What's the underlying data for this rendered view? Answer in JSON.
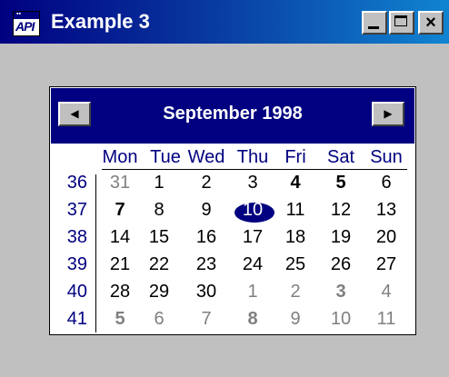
{
  "window": {
    "title": "Example 3",
    "icon": "app-icon"
  },
  "calendar": {
    "month": "September 1998",
    "days_of_week": [
      "Mon",
      "Tue",
      "Wed",
      "Thu",
      "Fri",
      "Sat",
      "Sun"
    ],
    "weeks": [
      {
        "num": "36",
        "days": [
          {
            "d": "31",
            "muted": true
          },
          {
            "d": "1"
          },
          {
            "d": "2"
          },
          {
            "d": "3"
          },
          {
            "d": "4",
            "bold": true
          },
          {
            "d": "5",
            "bold": true
          },
          {
            "d": "6"
          }
        ]
      },
      {
        "num": "37",
        "days": [
          {
            "d": "7",
            "bold": true
          },
          {
            "d": "8"
          },
          {
            "d": "9"
          },
          {
            "d": "10",
            "today": true
          },
          {
            "d": "11"
          },
          {
            "d": "12"
          },
          {
            "d": "13"
          }
        ]
      },
      {
        "num": "38",
        "days": [
          {
            "d": "14"
          },
          {
            "d": "15"
          },
          {
            "d": "16"
          },
          {
            "d": "17"
          },
          {
            "d": "18"
          },
          {
            "d": "19"
          },
          {
            "d": "20"
          }
        ]
      },
      {
        "num": "39",
        "days": [
          {
            "d": "21"
          },
          {
            "d": "22"
          },
          {
            "d": "23"
          },
          {
            "d": "24"
          },
          {
            "d": "25"
          },
          {
            "d": "26"
          },
          {
            "d": "27"
          }
        ]
      },
      {
        "num": "40",
        "days": [
          {
            "d": "28"
          },
          {
            "d": "29"
          },
          {
            "d": "30"
          },
          {
            "d": "1",
            "muted": true
          },
          {
            "d": "2",
            "muted": true
          },
          {
            "d": "3",
            "muted": true,
            "bold": true
          },
          {
            "d": "4",
            "muted": true
          }
        ]
      },
      {
        "num": "41",
        "days": [
          {
            "d": "5",
            "muted": true,
            "bold": true
          },
          {
            "d": "6",
            "muted": true
          },
          {
            "d": "7",
            "muted": true
          },
          {
            "d": "8",
            "muted": true,
            "bold": true
          },
          {
            "d": "9",
            "muted": true
          },
          {
            "d": "10",
            "muted": true
          },
          {
            "d": "11",
            "muted": true
          }
        ]
      }
    ]
  },
  "colors": {
    "accent": "#000080",
    "face": "#c0c0c0",
    "muted": "#808080"
  }
}
